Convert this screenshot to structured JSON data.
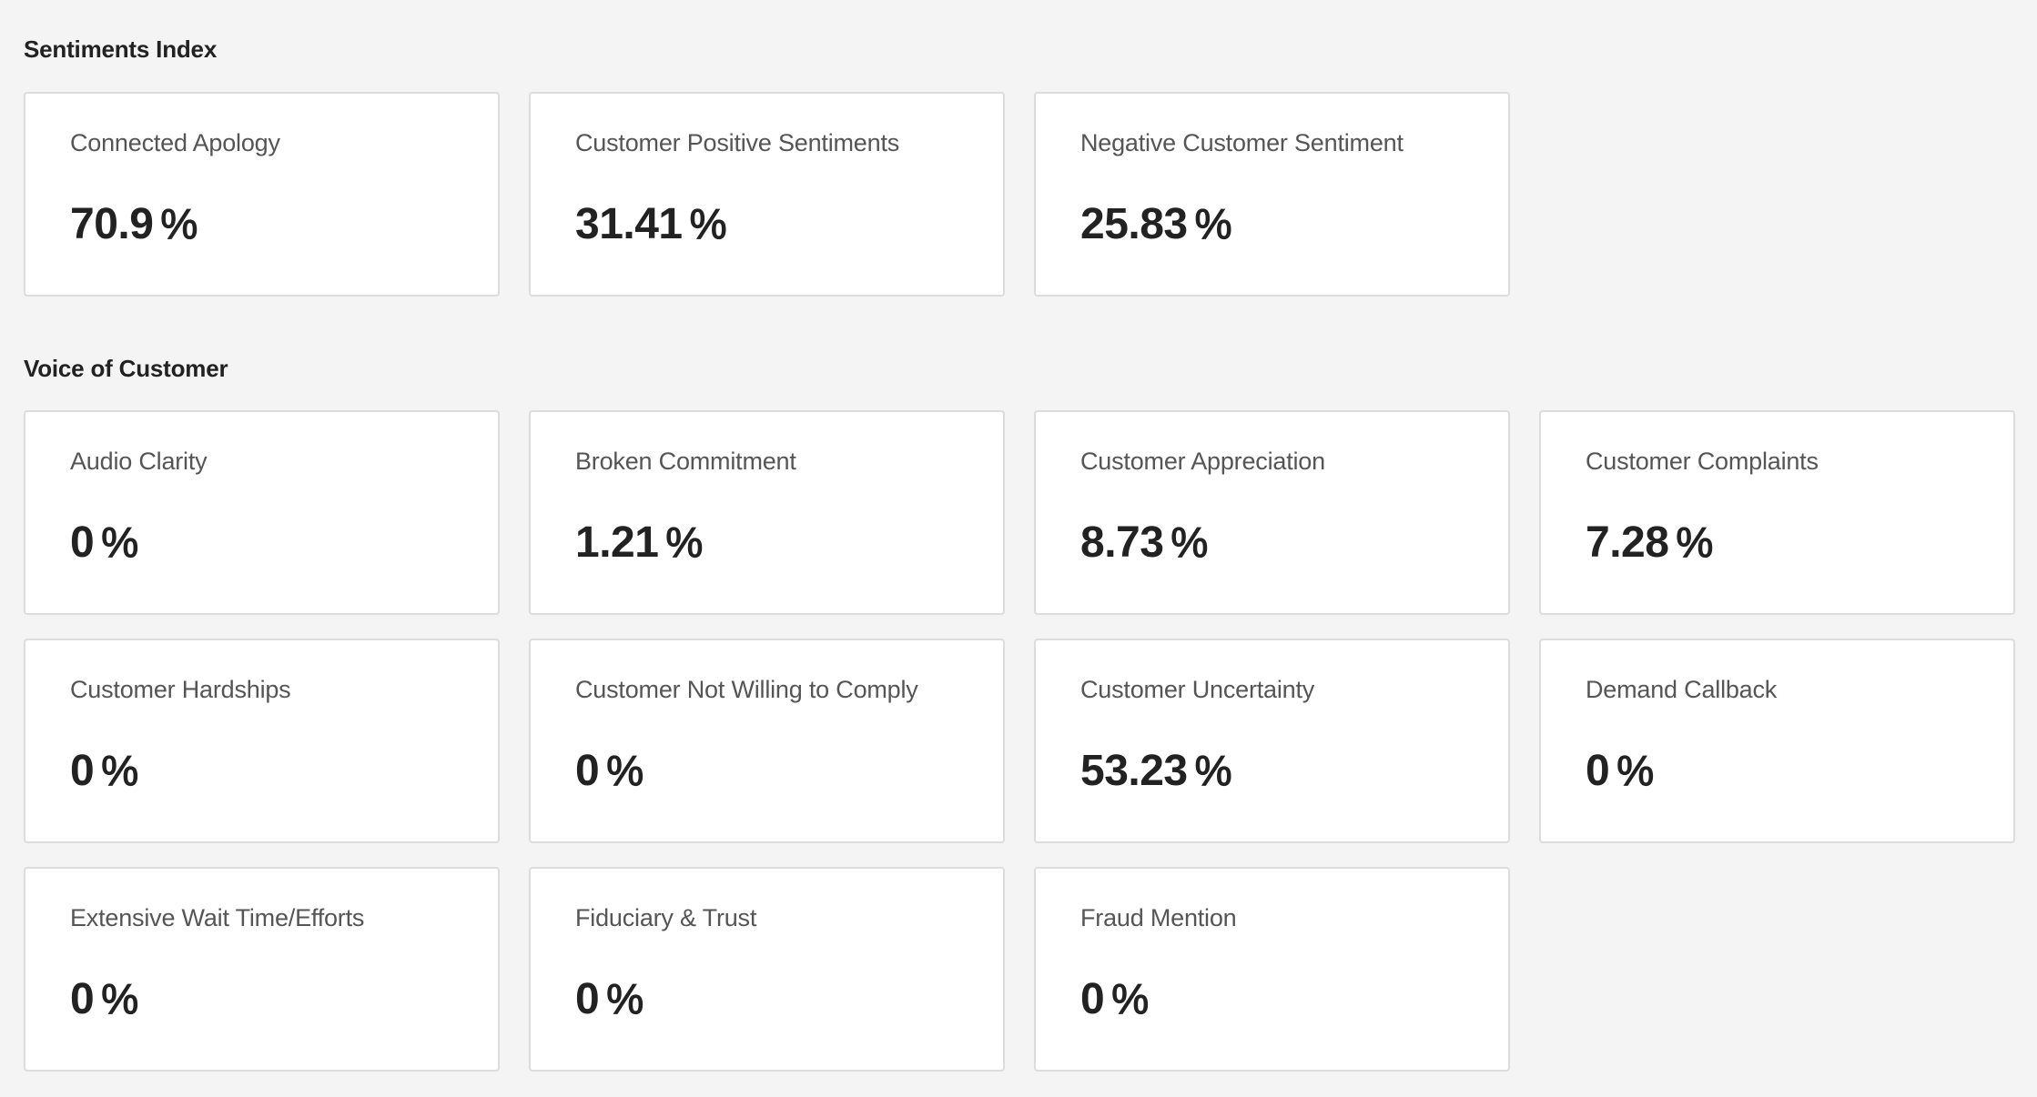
{
  "sections": {
    "sentiments": {
      "title": "Sentiments Index",
      "cards": [
        {
          "label": "Connected Apology",
          "value": "70.9",
          "unit": "%"
        },
        {
          "label": "Customer Positive Sentiments",
          "value": "31.41",
          "unit": "%"
        },
        {
          "label": "Negative Customer Sentiment",
          "value": "25.83",
          "unit": "%"
        }
      ]
    },
    "voice": {
      "title": "Voice of Customer",
      "cards": [
        {
          "label": "Audio Clarity",
          "value": "0",
          "unit": "%"
        },
        {
          "label": "Broken Commitment",
          "value": "1.21",
          "unit": "%"
        },
        {
          "label": "Customer Appreciation",
          "value": "8.73",
          "unit": "%"
        },
        {
          "label": "Customer Complaints",
          "value": "7.28",
          "unit": "%"
        },
        {
          "label": "Customer Hardships",
          "value": "0",
          "unit": "%"
        },
        {
          "label": "Customer Not Willing to Comply",
          "value": "0",
          "unit": "%"
        },
        {
          "label": "Customer Uncertainty",
          "value": "53.23",
          "unit": "%"
        },
        {
          "label": "Demand Callback",
          "value": "0",
          "unit": "%"
        },
        {
          "label": "Extensive Wait Time/Efforts",
          "value": "0",
          "unit": "%"
        },
        {
          "label": "Fiduciary & Trust",
          "value": "0",
          "unit": "%"
        },
        {
          "label": "Fraud Mention",
          "value": "0",
          "unit": "%"
        }
      ]
    }
  }
}
